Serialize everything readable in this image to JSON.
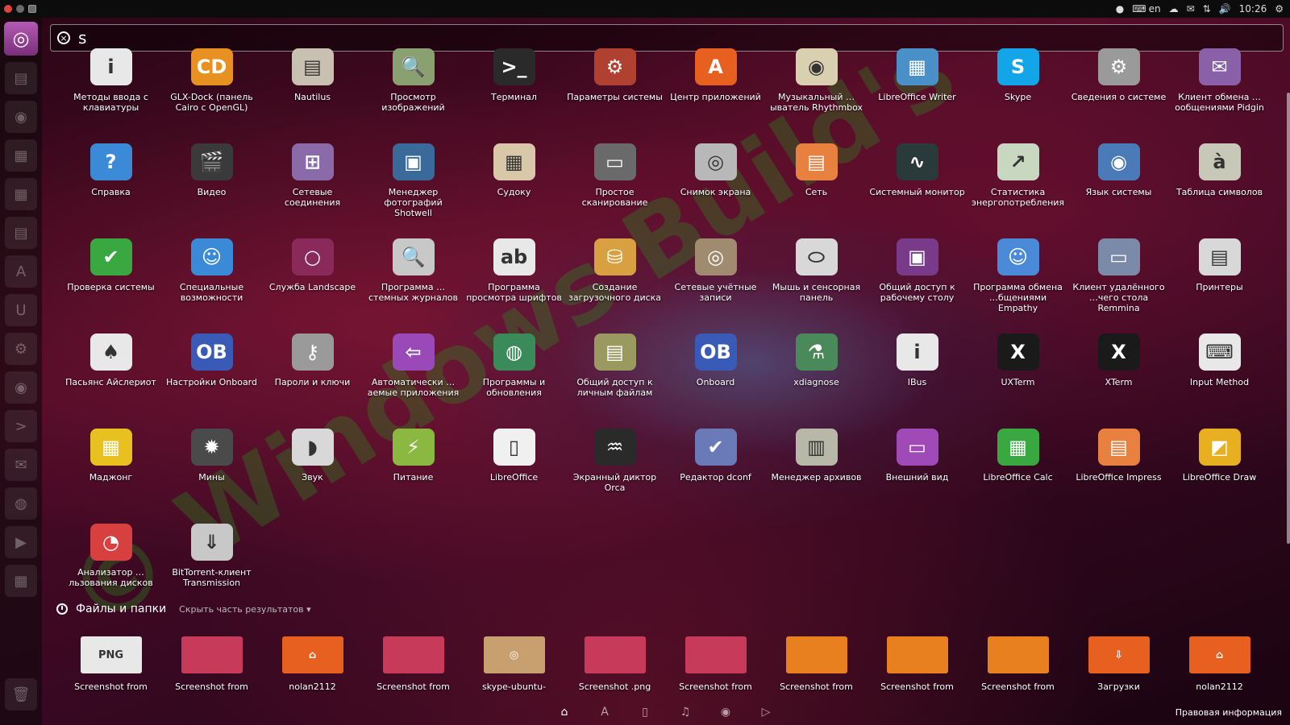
{
  "top_panel": {
    "keyboard_layout": "en",
    "clock": "10:26"
  },
  "search": {
    "query": "s"
  },
  "apps": [
    {
      "label": "Методы ввода с клавиатуры",
      "icon": "info-icon",
      "glyph": "i",
      "color": "#e8e8e8"
    },
    {
      "label": "GLX-Dock (панель Cairo с OpenGL)",
      "icon": "cd-icon",
      "glyph": "CD",
      "color": "#e89020"
    },
    {
      "label": "Nautilus",
      "icon": "file-cabinet-icon",
      "glyph": "▤",
      "color": "#c8c0b0"
    },
    {
      "label": "Просмотр изображений",
      "icon": "image-viewer-icon",
      "glyph": "🔍",
      "color": "#8aa070"
    },
    {
      "label": "Терминал",
      "icon": "terminal-icon",
      "glyph": ">_",
      "color": "#2a2a2a"
    },
    {
      "label": "Параметры системы",
      "icon": "system-settings-icon",
      "glyph": "⚙",
      "color": "#b04030"
    },
    {
      "label": "Центр приложений",
      "icon": "software-center-icon",
      "glyph": "A",
      "color": "#e86020"
    },
    {
      "label": "Музыкальный …ыватель Rhythmbox",
      "icon": "speaker-icon",
      "glyph": "◉",
      "color": "#d8d0b0"
    },
    {
      "label": "LibreOffice Writer",
      "icon": "writer-icon",
      "glyph": "▦",
      "color": "#4a90c8"
    },
    {
      "label": "Skype",
      "icon": "skype-icon",
      "glyph": "S",
      "color": "#12a5e8"
    },
    {
      "label": "Сведения о системе",
      "icon": "gear-icon",
      "glyph": "⚙",
      "color": "#9a9a9a"
    },
    {
      "label": "Клиент обмена …ообщениями Pidgin",
      "icon": "pidgin-icon",
      "glyph": "✉",
      "color": "#8a60a8"
    },
    {
      "label": "Справка",
      "icon": "help-icon",
      "glyph": "?",
      "color": "#3a8ad8"
    },
    {
      "label": "Видео",
      "icon": "clapperboard-icon",
      "glyph": "🎬",
      "color": "#3a3a3a"
    },
    {
      "label": "Сетевые соединения",
      "icon": "network-connections-icon",
      "glyph": "⊞",
      "color": "#8a6aa8"
    },
    {
      "label": "Менеджер фотографий Shotwell",
      "icon": "shotwell-icon",
      "glyph": "▣",
      "color": "#3a6a9a"
    },
    {
      "label": "Судоку",
      "icon": "sudoku-icon",
      "glyph": "▦",
      "color": "#d8c8a8"
    },
    {
      "label": "Простое сканирование",
      "icon": "scanner-icon",
      "glyph": "▭",
      "color": "#6a6a6a"
    },
    {
      "label": "Снимок экрана",
      "icon": "camera-icon",
      "glyph": "◎",
      "color": "#b8b8b8"
    },
    {
      "label": "Сеть",
      "icon": "network-folder-icon",
      "glyph": "▤",
      "color": "#e88040"
    },
    {
      "label": "Системный монитор",
      "icon": "system-monitor-icon",
      "glyph": "∿",
      "color": "#2a3a3a"
    },
    {
      "label": "Статистика энергопотребления",
      "icon": "power-stats-icon",
      "glyph": "↗",
      "color": "#c8d8c0"
    },
    {
      "label": "Язык системы",
      "icon": "language-icon",
      "glyph": "◉",
      "color": "#4a7ab8"
    },
    {
      "label": "Таблица символов",
      "icon": "character-map-icon",
      "glyph": "à",
      "color": "#c8c8b8"
    },
    {
      "label": "Проверка системы",
      "icon": "checkbox-icon",
      "glyph": "✔",
      "color": "#3aa840"
    },
    {
      "label": "Специальные возможности",
      "icon": "accessibility-icon",
      "glyph": "☺",
      "color": "#3a8ad8"
    },
    {
      "label": "Служба Landscape",
      "icon": "landscape-icon",
      "glyph": "○",
      "color": "#8a2a5a"
    },
    {
      "label": "Программа …стемных журналов",
      "icon": "log-viewer-icon",
      "glyph": "🔍",
      "color": "#c8c8c8"
    },
    {
      "label": "Программа просмотра шрифтов",
      "icon": "font-viewer-icon",
      "glyph": "ab",
      "color": "#e8e8e8"
    },
    {
      "label": "Создание загрузочного диска",
      "icon": "startup-disk-icon",
      "glyph": "⛁",
      "color": "#d8a040"
    },
    {
      "label": "Сетевые учётные записи",
      "icon": "online-accounts-icon",
      "glyph": "◎",
      "color": "#a08a70"
    },
    {
      "label": "Мышь и сенсорная панель",
      "icon": "mouse-icon",
      "glyph": "⬭",
      "color": "#d8d8d8"
    },
    {
      "label": "Общий доступ к рабочему столу",
      "icon": "desktop-sharing-icon",
      "glyph": "▣",
      "color": "#7a3a8a"
    },
    {
      "label": "Программа обмена …бщениями Empathy",
      "icon": "empathy-icon",
      "glyph": "☺",
      "color": "#4a8ad8"
    },
    {
      "label": "Клиент удалённого …чего стола Remmina",
      "icon": "remmina-icon",
      "glyph": "▭",
      "color": "#7a8aa8"
    },
    {
      "label": "Принтеры",
      "icon": "printer-icon",
      "glyph": "▤",
      "color": "#d8d8d8"
    },
    {
      "label": "Пасьянс Айслериот",
      "icon": "cards-icon",
      "glyph": "♠",
      "color": "#e8e8e8"
    },
    {
      "label": "Настройки Onboard",
      "icon": "onboard-settings-icon",
      "glyph": "OB",
      "color": "#3a5ab8"
    },
    {
      "label": "Пароли и ключи",
      "icon": "keys-icon",
      "glyph": "⚷",
      "color": "#9a9a9a"
    },
    {
      "label": "Автоматически …аемые приложения",
      "icon": "startup-apps-icon",
      "glyph": "⇦",
      "color": "#9a4ab8"
    },
    {
      "label": "Программы и обновления",
      "icon": "software-updates-icon",
      "glyph": "◍",
      "color": "#3a8a5a"
    },
    {
      "label": "Общий доступ к личным файлам",
      "icon": "shared-folder-icon",
      "glyph": "▤",
      "color": "#9a9a60"
    },
    {
      "label": "Onboard",
      "icon": "onboard-icon",
      "glyph": "OB",
      "color": "#3a5ab8"
    },
    {
      "label": "xdiagnose",
      "icon": "microscope-icon",
      "glyph": "⚗",
      "color": "#4a8a5a"
    },
    {
      "label": "IBus",
      "icon": "ibus-info-icon",
      "glyph": "i",
      "color": "#e8e8e8"
    },
    {
      "label": "UXTerm",
      "icon": "uxterm-icon",
      "glyph": "X",
      "color": "#1a1a1a"
    },
    {
      "label": "XTerm",
      "icon": "xterm-icon",
      "glyph": "X",
      "color": "#1a1a1a"
    },
    {
      "label": "Input Method",
      "icon": "keyboard-icon",
      "glyph": "⌨",
      "color": "#e8e8e8"
    },
    {
      "label": "Маджонг",
      "icon": "mahjong-icon",
      "glyph": "▦",
      "color": "#e8c020"
    },
    {
      "label": "Мины",
      "icon": "mine-icon",
      "glyph": "✹",
      "color": "#4a4a4a"
    },
    {
      "label": "Звук",
      "icon": "sound-icon",
      "glyph": "◗",
      "color": "#d8d8d8"
    },
    {
      "label": "Питание",
      "icon": "power-icon",
      "glyph": "⚡",
      "color": "#8ab840"
    },
    {
      "label": "LibreOffice",
      "icon": "libreoffice-icon",
      "glyph": "▯",
      "color": "#f0f0f0"
    },
    {
      "label": "Экранный диктор Orca",
      "icon": "orca-icon",
      "glyph": "♒",
      "color": "#2a2a2a"
    },
    {
      "label": "Редактор dconf",
      "icon": "dconf-icon",
      "glyph": "✔",
      "color": "#6a7ab8"
    },
    {
      "label": "Менеджер архивов",
      "icon": "archive-icon",
      "glyph": "▥",
      "color": "#b8b8a8"
    },
    {
      "label": "Внешний вид",
      "icon": "appearance-icon",
      "glyph": "▭",
      "color": "#a04ab8"
    },
    {
      "label": "LibreOffice Calc",
      "icon": "calc-icon",
      "glyph": "▦",
      "color": "#3aa840"
    },
    {
      "label": "LibreOffice Impress",
      "icon": "impress-icon",
      "glyph": "▤",
      "color": "#e88040"
    },
    {
      "label": "LibreOffice Draw",
      "icon": "draw-icon",
      "glyph": "◩",
      "color": "#e8b020"
    },
    {
      "label": "Анализатор …льзования дисков",
      "icon": "disk-usage-icon",
      "glyph": "◔",
      "color": "#d84040"
    },
    {
      "label": "BitTorrent-клиент Transmission",
      "icon": "transmission-icon",
      "glyph": "⇓",
      "color": "#c8c8c8"
    }
  ],
  "files_section": {
    "title": "Файлы и папки",
    "toggle": "Скрыть часть результатов"
  },
  "files": [
    {
      "label": "Screenshot from",
      "icon": "png-file-icon",
      "glyph": "PNG",
      "color": "#e8e8e8"
    },
    {
      "label": "Screenshot from",
      "icon": "screenshot-thumb-icon",
      "glyph": "",
      "color": "#c83a5a"
    },
    {
      "label": "nolan2112",
      "icon": "home-folder-icon",
      "glyph": "⌂",
      "color": "#e86020"
    },
    {
      "label": "Screenshot from",
      "icon": "screenshot-thumb-icon",
      "glyph": "",
      "color": "#c83a5a"
    },
    {
      "label": "skype-ubuntu-",
      "icon": "package-icon",
      "glyph": "◎",
      "color": "#c8a070"
    },
    {
      "label": "Screenshot .png",
      "icon": "screenshot-thumb-icon",
      "glyph": "",
      "color": "#c83a5a"
    },
    {
      "label": "Screenshot from",
      "icon": "screenshot-thumb-icon",
      "glyph": "",
      "color": "#c83a5a"
    },
    {
      "label": "Screenshot from",
      "icon": "screenshot-thumb-icon",
      "glyph": "",
      "color": "#e88020"
    },
    {
      "label": "Screenshot from",
      "icon": "screenshot-thumb-icon",
      "glyph": "",
      "color": "#e88020"
    },
    {
      "label": "Screenshot from",
      "icon": "screenshot-thumb-icon",
      "glyph": "",
      "color": "#e88020"
    },
    {
      "label": "Загрузки",
      "icon": "downloads-folder-icon",
      "glyph": "⇩",
      "color": "#e86020"
    },
    {
      "label": "nolan2112",
      "icon": "home-folder-icon",
      "glyph": "⌂",
      "color": "#e86020"
    }
  ],
  "footer": {
    "legal_link": "Правовая информация"
  },
  "watermark": "© Windows Build's"
}
